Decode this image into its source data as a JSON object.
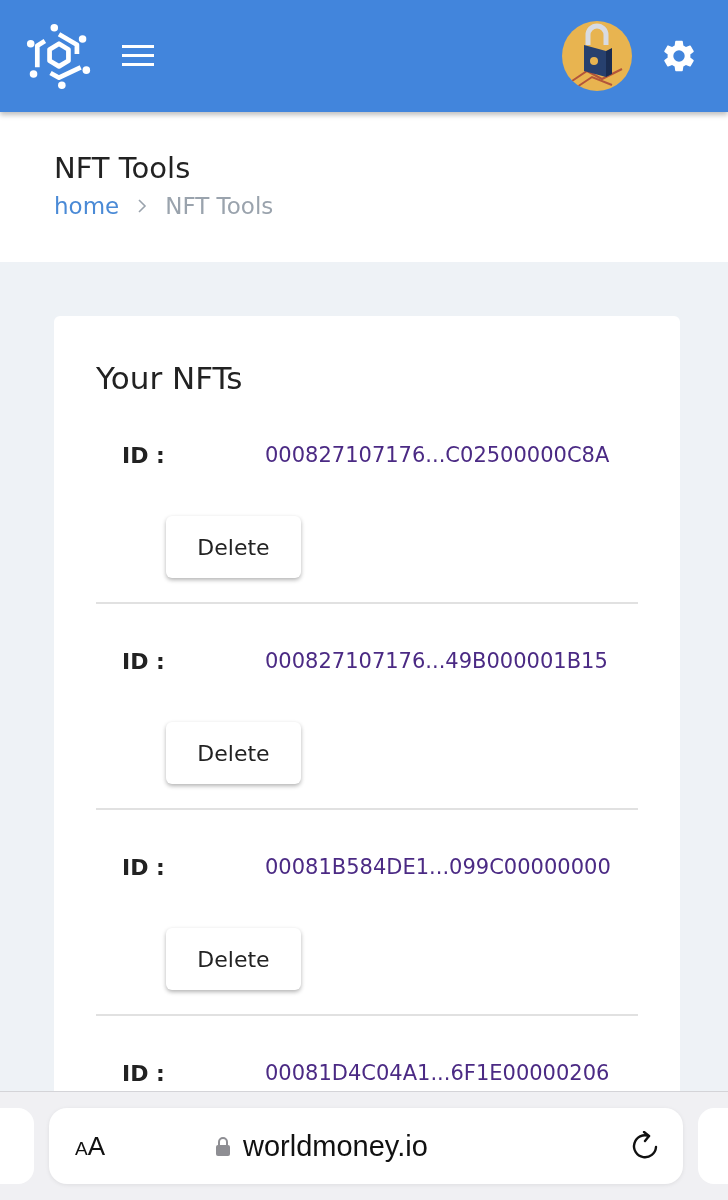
{
  "page_header": {
    "title": "NFT Tools",
    "breadcrumb": [
      {
        "label": "home",
        "link": true
      },
      {
        "label": "NFT Tools",
        "link": false
      }
    ]
  },
  "card": {
    "title": "Your NFTs",
    "items": [
      {
        "id_label": "ID :",
        "id": "000827107176...C02500000C8A",
        "button": "Delete"
      },
      {
        "id_label": "ID :",
        "id": "000827107176...49B000001B15",
        "button": "Delete"
      },
      {
        "id_label": "ID :",
        "id": "00081B584DE1...099C00000000",
        "button": "Delete"
      },
      {
        "id_label": "ID :",
        "id": "00081D4C04A1...6F1E00000206"
      }
    ]
  },
  "browser_bar": {
    "text_size": "AA",
    "url": "worldmoney.io"
  }
}
